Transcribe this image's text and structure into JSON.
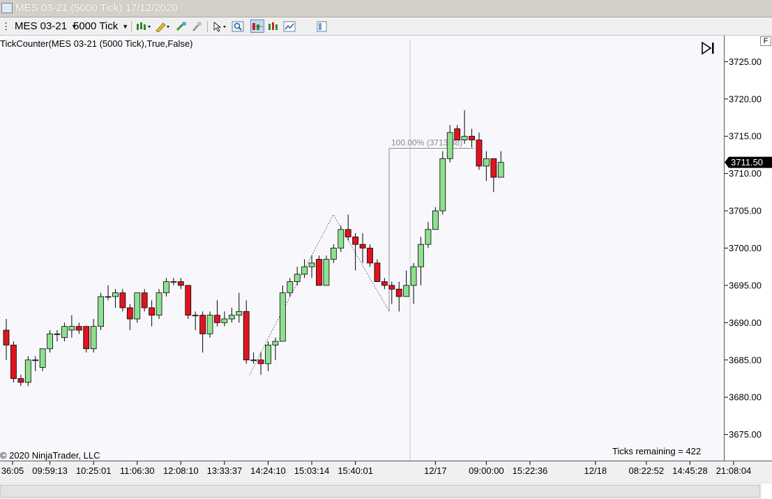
{
  "window": {
    "title": "MES 03-21 (5000 Tick)  17/12/2020"
  },
  "toolbar": {
    "instrument": "MES 03-21",
    "interval": "5000 Tick",
    "icons": [
      "candlestick-icon",
      "pencil-icon",
      "magnet-icon",
      "pin-icon",
      "cursor-icon",
      "zoom-icon",
      "bar-style-icon",
      "indicator-icon",
      "strategy-icon",
      "properties-icon"
    ]
  },
  "chart": {
    "indicator_label": "TickCounter(MES  03-21 (5000  Tick),True,False)",
    "copyright": "© 2020 NinjaTrader, LLC",
    "ticks_remaining": "Ticks remaining = 422",
    "price_marker": "3711.50",
    "fib_label": "100.00% (3713.38)",
    "axis_button": "F",
    "colors": {
      "up": "#8ee08e",
      "down": "#e0141e",
      "outline": "#000000",
      "background": "#f8f7fb"
    }
  },
  "chart_data": {
    "type": "candlestick",
    "title": "",
    "ylim": [
      3671.5,
      3728.5
    ],
    "y_ticks": [
      "3725.00",
      "3720.00",
      "3715.00",
      "3710.00",
      "3705.00",
      "3700.00",
      "3695.00",
      "3690.00",
      "3685.00",
      "3680.00",
      "3675.00"
    ],
    "y_tick_values": [
      3725,
      3720,
      3715,
      3710,
      3705,
      3700,
      3695,
      3690,
      3685,
      3680,
      3675
    ],
    "x_tick_labels": [
      "36:05",
      "09:59:13",
      "10:25:01",
      "11:06:30",
      "12:08:10",
      "13:33:37",
      "14:24:10",
      "15:03:14",
      "15:40:01",
      "12/17",
      "09:00:00",
      "15:22:36",
      "12/18",
      "08:22:52",
      "14:45:28",
      "21:08:04"
    ],
    "x_tick_bars": [
      0,
      6,
      12,
      18,
      24,
      30,
      36,
      42,
      48,
      59,
      66,
      72,
      81,
      88,
      94,
      100
    ],
    "candles": [
      [
        3689.0,
        3690.5,
        3685.0,
        3687.0
      ],
      [
        3687.0,
        3687.5,
        3682.0,
        3682.5
      ],
      [
        3682.5,
        3683.0,
        3681.5,
        3682.0
      ],
      [
        3682.0,
        3685.5,
        3681.5,
        3685.0
      ],
      [
        3685.0,
        3685.5,
        3683.5,
        3685.0
      ],
      [
        3684.0,
        3686.5,
        3683.5,
        3686.5
      ],
      [
        3686.5,
        3689.0,
        3686.0,
        3688.5
      ],
      [
        3688.5,
        3689.0,
        3687.5,
        3688.5
      ],
      [
        3688.0,
        3690.0,
        3687.5,
        3689.5
      ],
      [
        3689.0,
        3691.0,
        3688.0,
        3689.5
      ],
      [
        3689.5,
        3690.0,
        3688.5,
        3689.0
      ],
      [
        3689.5,
        3689.5,
        3686.0,
        3686.5
      ],
      [
        3686.5,
        3690.5,
        3686.0,
        3689.5
      ],
      [
        3689.5,
        3694.0,
        3689.0,
        3693.5
      ],
      [
        3693.5,
        3695.0,
        3693.0,
        3693.5
      ],
      [
        3693.5,
        3694.5,
        3692.0,
        3694.0
      ],
      [
        3694.0,
        3694.5,
        3691.5,
        3692.0
      ],
      [
        3692.0,
        3692.5,
        3689.0,
        3690.5
      ],
      [
        3690.5,
        3694.0,
        3690.0,
        3694.0
      ],
      [
        3694.0,
        3694.5,
        3691.5,
        3692.0
      ],
      [
        3692.0,
        3693.0,
        3689.5,
        3691.0
      ],
      [
        3691.0,
        3694.5,
        3690.5,
        3694.0
      ],
      [
        3694.0,
        3696.0,
        3693.5,
        3695.5
      ],
      [
        3695.5,
        3696.0,
        3695.0,
        3695.5
      ],
      [
        3695.5,
        3696.0,
        3694.5,
        3695.0
      ],
      [
        3695.0,
        3695.0,
        3690.5,
        3691.0
      ],
      [
        3691.0,
        3691.5,
        3689.0,
        3691.0
      ],
      [
        3691.0,
        3691.5,
        3686.0,
        3688.5
      ],
      [
        3688.5,
        3691.5,
        3688.0,
        3691.0
      ],
      [
        3691.0,
        3693.0,
        3689.5,
        3690.0
      ],
      [
        3690.0,
        3691.5,
        3689.5,
        3690.5
      ],
      [
        3690.5,
        3692.0,
        3690.0,
        3691.0
      ],
      [
        3691.0,
        3694.0,
        3690.0,
        3691.5
      ],
      [
        3691.5,
        3693.0,
        3684.5,
        3685.0
      ],
      [
        3685.0,
        3686.0,
        3684.5,
        3685.0
      ],
      [
        3685.0,
        3686.0,
        3683.0,
        3684.5
      ],
      [
        3684.5,
        3687.5,
        3683.5,
        3687.0
      ],
      [
        3687.0,
        3688.0,
        3685.0,
        3687.5
      ],
      [
        3687.5,
        3695.0,
        3687.5,
        3694.0
      ],
      [
        3694.0,
        3696.0,
        3693.5,
        3695.5
      ],
      [
        3695.5,
        3697.5,
        3695.0,
        3696.5
      ],
      [
        3696.5,
        3698.5,
        3696.0,
        3697.5
      ],
      [
        3697.5,
        3699.0,
        3696.0,
        3698.0
      ],
      [
        3698.5,
        3699.0,
        3695.0,
        3695.0
      ],
      [
        3695.0,
        3699.0,
        3695.0,
        3698.5
      ],
      [
        3698.5,
        3700.5,
        3698.0,
        3700.0
      ],
      [
        3700.0,
        3703.0,
        3699.5,
        3702.5
      ],
      [
        3702.5,
        3704.5,
        3701.0,
        3701.5
      ],
      [
        3701.5,
        3702.0,
        3697.0,
        3700.5
      ],
      [
        3700.5,
        3702.0,
        3698.0,
        3700.0
      ],
      [
        3700.0,
        3700.5,
        3697.5,
        3698.0
      ],
      [
        3698.0,
        3698.5,
        3695.5,
        3695.5
      ],
      [
        3695.5,
        3696.0,
        3694.5,
        3695.0
      ],
      [
        3695.0,
        3695.5,
        3692.5,
        3694.5
      ],
      [
        3694.5,
        3695.5,
        3691.5,
        3693.5
      ],
      [
        3693.5,
        3697.0,
        3693.5,
        3695.0
      ],
      [
        3695.0,
        3698.0,
        3692.5,
        3697.5
      ],
      [
        3697.5,
        3701.5,
        3695.0,
        3700.5
      ],
      [
        3700.5,
        3703.5,
        3700.0,
        3702.5
      ],
      [
        3702.5,
        3705.5,
        3702.5,
        3705.0
      ],
      [
        3705.0,
        3713.0,
        3704.5,
        3712.0
      ],
      [
        3712.0,
        3716.5,
        3711.5,
        3715.5
      ],
      [
        3716.0,
        3716.5,
        3714.5,
        3714.5
      ],
      [
        3714.5,
        3718.5,
        3714.0,
        3715.0
      ],
      [
        3715.0,
        3716.0,
        3713.5,
        3714.5
      ],
      [
        3714.5,
        3715.5,
        3710.5,
        3711.0
      ],
      [
        3711.0,
        3713.0,
        3709.0,
        3712.0
      ],
      [
        3712.0,
        3712.0,
        3707.5,
        3709.5
      ],
      [
        3709.5,
        3713.0,
        3709.5,
        3711.5
      ]
    ]
  }
}
